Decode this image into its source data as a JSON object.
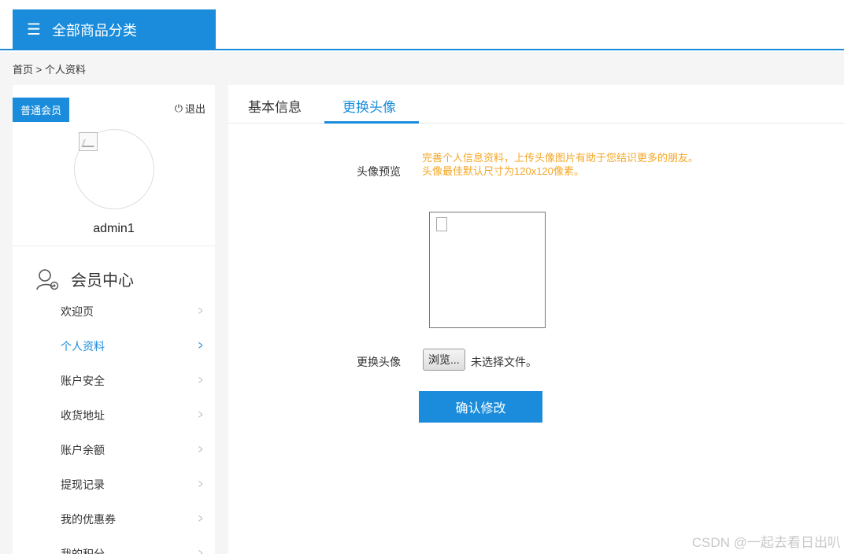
{
  "header": {
    "category_label": "全部商品分类"
  },
  "breadcrumb": "首页 > 个人资料",
  "sidebar": {
    "member_level": "普通会员",
    "logout_label": "退出",
    "username": "admin1",
    "section_title": "会员中心",
    "items": [
      {
        "label": "欢迎页"
      },
      {
        "label": "个人资料"
      },
      {
        "label": "账户安全"
      },
      {
        "label": "收货地址"
      },
      {
        "label": "账户余额"
      },
      {
        "label": "提现记录"
      },
      {
        "label": "我的优惠券"
      },
      {
        "label": "我的积分"
      }
    ],
    "active_item": "个人资料"
  },
  "tabs": [
    {
      "label": "基本信息"
    },
    {
      "label": "更换头像"
    }
  ],
  "active_tab": "更换头像",
  "form": {
    "preview_label": "头像预览",
    "hint_line1": "完善个人信息资料，上传头像图片有助于您结识更多的朋友。",
    "hint_line2": "头像最佳默认尺寸为120x120像素。",
    "change_label": "更换头像",
    "browse_label": "浏览...",
    "file_status": "未选择文件。",
    "submit_label": "确认修改"
  },
  "watermark": "CSDN @一起去看日出叭",
  "colors": {
    "accent": "#1a8cdb",
    "hint": "#f5a623"
  }
}
